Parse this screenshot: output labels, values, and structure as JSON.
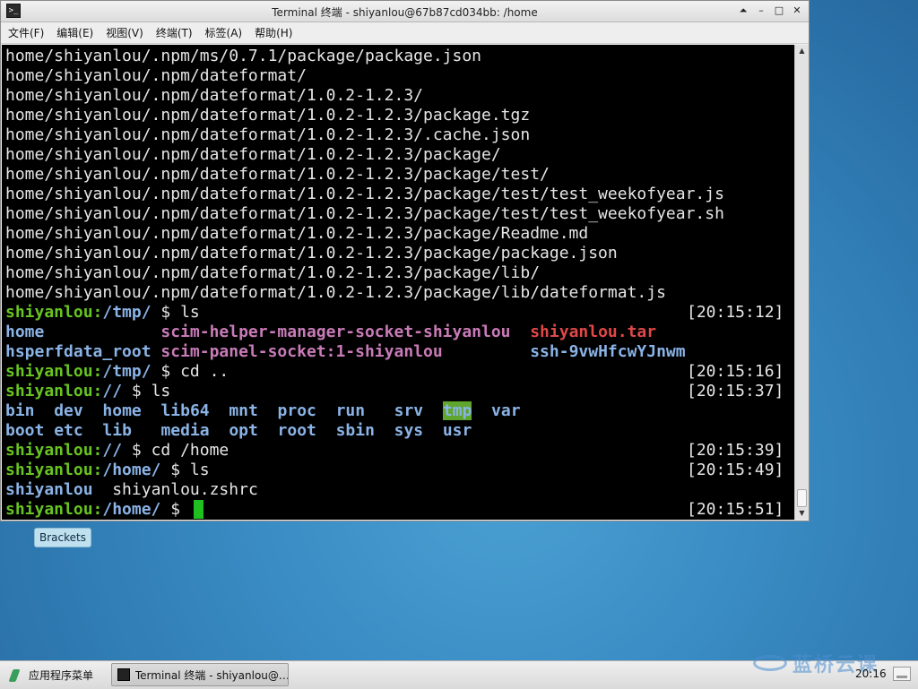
{
  "window": {
    "title": "Terminal 终端 - shiyanlou@67b87cd034bb: /home",
    "controls": [
      "⏶",
      "–",
      "□",
      "✕"
    ]
  },
  "menubar": {
    "items": [
      "文件(F)",
      "编辑(E)",
      "视图(V)",
      "终端(T)",
      "标签(A)",
      "帮助(H)"
    ]
  },
  "terminal": {
    "lines": [
      {
        "segs": [
          {
            "t": "home/shiyanlou/.npm/ms/0.7.1/package/package.json",
            "c": "plain"
          }
        ]
      },
      {
        "segs": [
          {
            "t": "home/shiyanlou/.npm/dateformat/",
            "c": "plain"
          }
        ]
      },
      {
        "segs": [
          {
            "t": "home/shiyanlou/.npm/dateformat/1.0.2-1.2.3/",
            "c": "plain"
          }
        ]
      },
      {
        "segs": [
          {
            "t": "home/shiyanlou/.npm/dateformat/1.0.2-1.2.3/package.tgz",
            "c": "plain"
          }
        ]
      },
      {
        "segs": [
          {
            "t": "home/shiyanlou/.npm/dateformat/1.0.2-1.2.3/.cache.json",
            "c": "plain"
          }
        ]
      },
      {
        "segs": [
          {
            "t": "home/shiyanlou/.npm/dateformat/1.0.2-1.2.3/package/",
            "c": "plain"
          }
        ]
      },
      {
        "segs": [
          {
            "t": "home/shiyanlou/.npm/dateformat/1.0.2-1.2.3/package/test/",
            "c": "plain"
          }
        ]
      },
      {
        "segs": [
          {
            "t": "home/shiyanlou/.npm/dateformat/1.0.2-1.2.3/package/test/test_weekofyear.js",
            "c": "plain"
          }
        ]
      },
      {
        "segs": [
          {
            "t": "home/shiyanlou/.npm/dateformat/1.0.2-1.2.3/package/test/test_weekofyear.sh",
            "c": "plain"
          }
        ]
      },
      {
        "segs": [
          {
            "t": "home/shiyanlou/.npm/dateformat/1.0.2-1.2.3/package/Readme.md",
            "c": "plain"
          }
        ]
      },
      {
        "segs": [
          {
            "t": "home/shiyanlou/.npm/dateformat/1.0.2-1.2.3/package/package.json",
            "c": "plain"
          }
        ]
      },
      {
        "segs": [
          {
            "t": "home/shiyanlou/.npm/dateformat/1.0.2-1.2.3/package/lib/",
            "c": "plain"
          }
        ]
      },
      {
        "segs": [
          {
            "t": "home/shiyanlou/.npm/dateformat/1.0.2-1.2.3/package/lib/dateformat.js",
            "c": "plain"
          }
        ]
      },
      {
        "segs": [
          {
            "t": "shiyanlou:",
            "c": "user"
          },
          {
            "t": "/tmp/",
            "c": "path"
          },
          {
            "t": " $ ls",
            "c": "cmd"
          }
        ],
        "time": "[20:15:12]"
      },
      {
        "segs": [
          {
            "t": "home            ",
            "c": "dir"
          },
          {
            "t": "scim-helper-manager-socket-shiyanlou",
            "c": "sock"
          },
          {
            "t": "  ",
            "c": "plain"
          },
          {
            "t": "shiyanlou.tar",
            "c": "arch"
          }
        ]
      },
      {
        "segs": [
          {
            "t": "hsperfdata_root ",
            "c": "dir"
          },
          {
            "t": "scim-panel-socket:1-shiyanlou",
            "c": "sock"
          },
          {
            "t": "         ",
            "c": "plain"
          },
          {
            "t": "ssh-9vwHfcwYJnwm",
            "c": "dir"
          }
        ]
      },
      {
        "segs": [
          {
            "t": "shiyanlou:",
            "c": "user"
          },
          {
            "t": "/tmp/",
            "c": "path"
          },
          {
            "t": " $ cd ..",
            "c": "cmd"
          }
        ],
        "time": "[20:15:16]"
      },
      {
        "segs": [
          {
            "t": "shiyanlou:",
            "c": "user"
          },
          {
            "t": "//",
            "c": "path"
          },
          {
            "t": " $ ls",
            "c": "cmd"
          }
        ],
        "time": "[20:15:37]"
      },
      {
        "segs": [
          {
            "t": "bin",
            "c": "dir"
          },
          {
            "t": "  ",
            "c": "plain"
          },
          {
            "t": "dev",
            "c": "dir"
          },
          {
            "t": "  ",
            "c": "plain"
          },
          {
            "t": "home",
            "c": "dir"
          },
          {
            "t": "  ",
            "c": "plain"
          },
          {
            "t": "lib64",
            "c": "dir"
          },
          {
            "t": "  ",
            "c": "plain"
          },
          {
            "t": "mnt",
            "c": "dir"
          },
          {
            "t": "  ",
            "c": "plain"
          },
          {
            "t": "proc",
            "c": "dir"
          },
          {
            "t": "  ",
            "c": "plain"
          },
          {
            "t": "run",
            "c": "dir"
          },
          {
            "t": "   ",
            "c": "plain"
          },
          {
            "t": "srv",
            "c": "dir"
          },
          {
            "t": "  ",
            "c": "plain"
          },
          {
            "t": "tmp",
            "c": "hl"
          },
          {
            "t": "  ",
            "c": "plain"
          },
          {
            "t": "var",
            "c": "dir"
          }
        ]
      },
      {
        "segs": [
          {
            "t": "boot",
            "c": "dir"
          },
          {
            "t": " ",
            "c": "plain"
          },
          {
            "t": "etc",
            "c": "dir"
          },
          {
            "t": "  ",
            "c": "plain"
          },
          {
            "t": "lib",
            "c": "dir"
          },
          {
            "t": "   ",
            "c": "plain"
          },
          {
            "t": "media",
            "c": "dir"
          },
          {
            "t": "  ",
            "c": "plain"
          },
          {
            "t": "opt",
            "c": "dir"
          },
          {
            "t": "  ",
            "c": "plain"
          },
          {
            "t": "root",
            "c": "dir"
          },
          {
            "t": "  ",
            "c": "plain"
          },
          {
            "t": "sbin",
            "c": "dir"
          },
          {
            "t": "  ",
            "c": "plain"
          },
          {
            "t": "sys",
            "c": "dir"
          },
          {
            "t": "  ",
            "c": "plain"
          },
          {
            "t": "usr",
            "c": "dir"
          }
        ]
      },
      {
        "segs": [
          {
            "t": "shiyanlou:",
            "c": "user"
          },
          {
            "t": "//",
            "c": "path"
          },
          {
            "t": " $ cd /home",
            "c": "cmd"
          }
        ],
        "time": "[20:15:39]"
      },
      {
        "segs": [
          {
            "t": "shiyanlou:",
            "c": "user"
          },
          {
            "t": "/home/",
            "c": "path"
          },
          {
            "t": " $ ls",
            "c": "cmd"
          }
        ],
        "time": "[20:15:49]"
      },
      {
        "segs": [
          {
            "t": "shiyanlou",
            "c": "dir"
          },
          {
            "t": "  shiyanlou.zshrc",
            "c": "plain"
          }
        ]
      },
      {
        "segs": [
          {
            "t": "shiyanlou:",
            "c": "user"
          },
          {
            "t": "/home/",
            "c": "path"
          },
          {
            "t": " $ ",
            "c": "cmd"
          }
        ],
        "time": "[20:15:51]"
      }
    ]
  },
  "desktop": {
    "launcher_label": "Brackets"
  },
  "taskbar": {
    "app_menu_label": "应用程序菜单",
    "task_label": "Terminal 终端 - shiyanlou@…",
    "clock": "20:16",
    "watermark": "蓝桥云课"
  },
  "colors": {
    "user": "#67c421",
    "path": "#8ab3e6",
    "socket": "#c97bb8",
    "archive": "#e04848",
    "highlight_bg": "#5fa52e",
    "cursor": "#20c020"
  }
}
